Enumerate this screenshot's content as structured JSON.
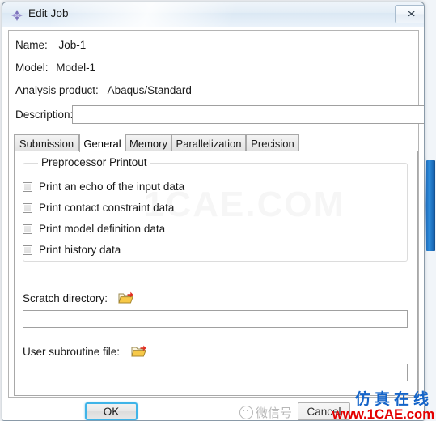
{
  "window": {
    "title": "Edit Job",
    "icon": "abaqus-diamond-icon",
    "close_label": "✕"
  },
  "fields": {
    "name_label": "Name:",
    "name_value": "Job-1",
    "model_label": "Model:",
    "model_value": "Model-1",
    "product_label": "Analysis product:",
    "product_value": "Abaqus/Standard",
    "description_label": "Description:",
    "description_value": "",
    "description_placeholder": ""
  },
  "tabs": [
    {
      "label": "Submission",
      "active": false
    },
    {
      "label": "General",
      "active": true
    },
    {
      "label": "Memory",
      "active": false
    },
    {
      "label": "Parallelization",
      "active": false
    },
    {
      "label": "Precision",
      "active": false
    }
  ],
  "general_tab": {
    "group_title": "Preprocessor Printout",
    "checkboxes": [
      {
        "label": "Print an echo of the input data",
        "checked": false
      },
      {
        "label": "Print contact constraint data",
        "checked": false
      },
      {
        "label": "Print model definition data",
        "checked": false
      },
      {
        "label": "Print history data",
        "checked": false
      }
    ],
    "scratch": {
      "label": "Scratch directory:",
      "icon": "open-folder-icon",
      "value": "",
      "placeholder": ""
    },
    "subroutine": {
      "label": "User subroutine file:",
      "icon": "open-folder-icon",
      "value": "",
      "placeholder": ""
    }
  },
  "buttons": {
    "ok": "OK",
    "cancel": "Cancel"
  },
  "watermarks": {
    "center": "1CAE.COM",
    "wechat": "微信号",
    "chinese": "仿真在线",
    "url": "www.1CAE.com"
  },
  "colors": {
    "focus_ring": "#3fb4e8",
    "scrollbar_blue": "#1d6fc0",
    "watermark_red": "#e40000",
    "watermark_blue": "#1464c8",
    "icon_purple": "#8e86c8",
    "folder_yellow": "#f5c542"
  }
}
